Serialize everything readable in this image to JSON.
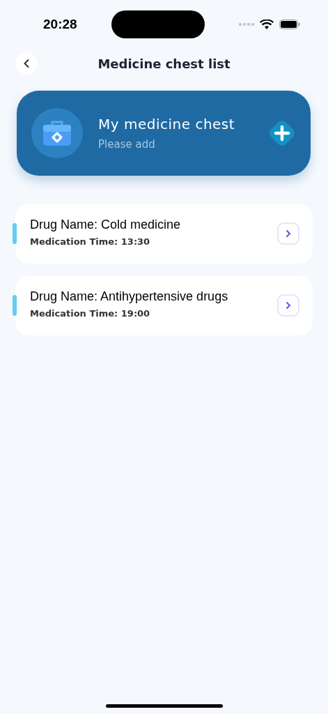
{
  "status_bar": {
    "time": "20:28"
  },
  "header": {
    "title": "Medicine chest list"
  },
  "chest": {
    "title": "My medicine chest",
    "subtitle": "Please add"
  },
  "medications": [
    {
      "name": "Drug Name: Cold medicine",
      "time": "Medication Time: 13:30"
    },
    {
      "name": "Drug Name: Antihypertensive drugs",
      "time": "Medication Time: 19:00"
    }
  ]
}
